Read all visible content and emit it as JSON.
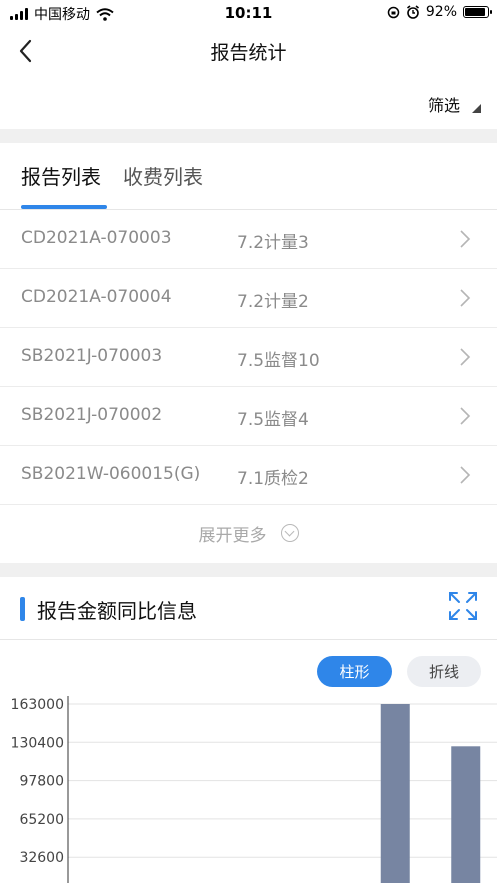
{
  "status": {
    "carrier": "中国移动",
    "time": "10:11",
    "battery": "92%"
  },
  "nav": {
    "title": "报告统计"
  },
  "filter": {
    "label": "筛选"
  },
  "tabs": [
    {
      "label": "报告列表"
    },
    {
      "label": "收费列表"
    }
  ],
  "reports": [
    {
      "code": "CD2021A-070003",
      "name": "7.2计量3"
    },
    {
      "code": "CD2021A-070004",
      "name": "7.2计量2"
    },
    {
      "code": "SB2021J-070003",
      "name": "7.5监督10"
    },
    {
      "code": "SB2021J-070002",
      "name": "7.5监督4"
    },
    {
      "code": "SB2021W-060015(G)",
      "name": "7.1质检2"
    }
  ],
  "expand": {
    "label": "展开更多"
  },
  "chart_section": {
    "title": "报告金额同比信息",
    "toggle_bar": "柱形",
    "toggle_line": "折线"
  },
  "colors": {
    "accent": "#2f86e9",
    "bar": "#7785a2"
  },
  "chart_data": {
    "type": "bar",
    "y_ticks": [
      "163000",
      "130400",
      "97800",
      "65200",
      "32600"
    ],
    "ylim": [
      0,
      163000
    ],
    "categories": [
      "",
      "",
      "",
      "",
      "",
      ""
    ],
    "values": [
      0,
      0,
      2000,
      4500,
      163000,
      127000
    ]
  }
}
